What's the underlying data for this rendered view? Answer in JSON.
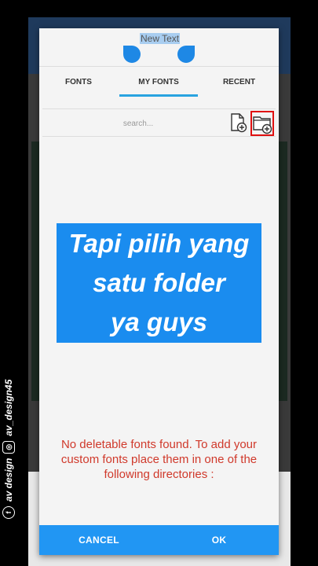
{
  "watermark": {
    "brand": "av design",
    "handle": "av_design45"
  },
  "preview": {
    "text": "New Text"
  },
  "tabs": [
    {
      "label": "FONTS"
    },
    {
      "label": "MY FONTS"
    },
    {
      "label": "RECENT"
    }
  ],
  "search": {
    "placeholder": "search...",
    "add_file_icon": "add-file-icon",
    "add_folder_icon": "add-folder-icon"
  },
  "overlay": {
    "line1": "Tapi pilih yang",
    "line2": "satu folder",
    "line3": "ya guys"
  },
  "message": {
    "text": "No deletable fonts found. To add your custom fonts place them in one of the following directories :"
  },
  "footer": {
    "cancel_label": "CANCEL",
    "ok_label": "OK"
  },
  "colors": {
    "accent": "#2196f3",
    "tab_indicator": "#29a3e0",
    "highlight_box": "#e01010",
    "message": "#d0392b"
  }
}
